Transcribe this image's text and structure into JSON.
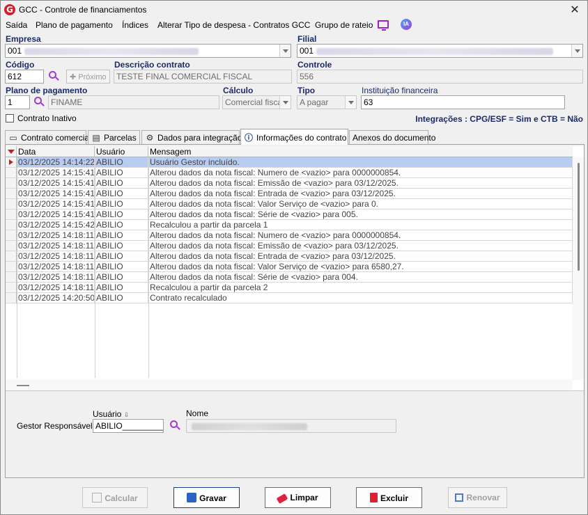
{
  "window": {
    "title": "GCC - Controle de financiamentos",
    "app_icon_letter": "G"
  },
  "menu": {
    "items": [
      "Saída",
      "Plano de pagamento",
      "Índices",
      "Alterar Tipo de despesa - Contratos GCC",
      "Grupo de rateio"
    ],
    "ia_label": "IA"
  },
  "form": {
    "empresa_label": "Empresa",
    "empresa_value": "001",
    "filial_label": "Filial",
    "filial_value": "001",
    "codigo_label": "Código",
    "codigo_value": "612",
    "proximo_label": "Próximo",
    "descricao_label": "Descrição contrato",
    "descricao_value": "TESTE FINAL COMERCIAL FISCAL",
    "controle_label": "Controle",
    "controle_value": "556",
    "plano_label": "Plano de pagamento",
    "plano_code": "1",
    "plano_value": "FINAME",
    "calculo_label": "Cálculo",
    "calculo_value": "Comercial fiscal",
    "tipo_label": "Tipo",
    "tipo_value": "A pagar",
    "instituicao_label": "Instituição financeira",
    "instituicao_value": "63",
    "inativo_label": "Contrato Inativo",
    "integracoes_text": "Integrações : CPG/ESF = Sim e CTB = Não"
  },
  "tabs": [
    {
      "label": "Contrato comercial"
    },
    {
      "label": "Parcelas"
    },
    {
      "label": "Dados para integração"
    },
    {
      "label": "Informações do contrato"
    },
    {
      "label": "Anexos do documento"
    }
  ],
  "grid": {
    "headers": [
      "Data",
      "Usuário",
      "Mensagem"
    ],
    "rows": [
      [
        "03/12/2025 14:14:22",
        "ABILIO",
        "Usuário Gestor incluído."
      ],
      [
        "03/12/2025 14:15:41",
        "ABILIO",
        "Alterou dados da nota fiscal: Numero de <vazio> para 0000000854."
      ],
      [
        "03/12/2025 14:15:41",
        "ABILIO",
        "Alterou dados da nota fiscal: Emissão de <vazio> para 03/12/2025."
      ],
      [
        "03/12/2025 14:15:41",
        "ABILIO",
        "Alterou dados da nota fiscal: Entrada de <vazio> para 03/12/2025."
      ],
      [
        "03/12/2025 14:15:41",
        "ABILIO",
        "Alterou dados da nota fiscal: Valor Serviço de <vazio> para 0."
      ],
      [
        "03/12/2025 14:15:41",
        "ABILIO",
        "Alterou dados da nota fiscal: Série de <vazio> para 005."
      ],
      [
        "03/12/2025 14:15:42",
        "ABILIO",
        "Recalculou a partir da parcela 1"
      ],
      [
        "03/12/2025 14:18:11",
        "ABILIO",
        "Alterou dados da nota fiscal: Numero de <vazio> para 0000000854."
      ],
      [
        "03/12/2025 14:18:11",
        "ABILIO",
        "Alterou dados da nota fiscal: Emissão de <vazio> para 03/12/2025."
      ],
      [
        "03/12/2025 14:18:11",
        "ABILIO",
        "Alterou dados da nota fiscal: Entrada de <vazio> para 03/12/2025."
      ],
      [
        "03/12/2025 14:18:11",
        "ABILIO",
        "Alterou dados da nota fiscal: Valor Serviço de <vazio> para 6580,27."
      ],
      [
        "03/12/2025 14:18:11",
        "ABILIO",
        "Alterou dados da nota fiscal: Série de <vazio> para 004."
      ],
      [
        "03/12/2025 14:18:11",
        "ABILIO",
        "Recalculou a partir da parcela 2"
      ],
      [
        "03/12/2025 14:20:50",
        "ABILIO",
        "Contrato recalculado"
      ]
    ]
  },
  "gestor": {
    "label": "Gestor Responsável:",
    "usuario_label": "Usuário",
    "usuario_value": "ABILIO_________",
    "nome_label": "Nome"
  },
  "buttons": {
    "calcular": "Calcular",
    "gravar": "Gravar",
    "limpar": "Limpar",
    "excluir": "Excluir",
    "renovar": "Renovar"
  }
}
